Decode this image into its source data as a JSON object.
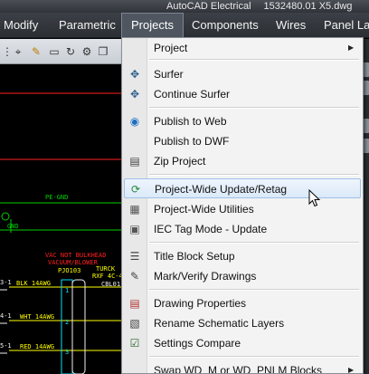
{
  "window": {
    "app_title": "AutoCAD Electrical",
    "document": "1532480.01 X5.dwg"
  },
  "menubar": {
    "items": [
      "Modify",
      "Parametric",
      "Projects",
      "Components",
      "Wires",
      "Panel Lay"
    ],
    "active": "Projects"
  },
  "drawing": {
    "labels": {
      "pe_gnd_top": "PE-GND",
      "gnd": "GND",
      "vac_note_1": "VAC NOT BULKHEAD",
      "vac_note_2": "VACUUM/BLOWER",
      "pjo103": "PJO103",
      "turck": "TURCK",
      "rxf": "RXF 4C-4C-",
      "blk": "BLK_14AWG",
      "wht": "WHT_14AWG",
      "red": "RED_14AWG",
      "cbl": "CBL01",
      "num_1": "1",
      "num_2": "2",
      "num_3": "3",
      "row_a": "3-1",
      "row_b": "4-1",
      "row_c": "5-1"
    },
    "colors": {
      "green": "#00d000",
      "yellow": "#ffff00",
      "red": "#ff2020",
      "cyan": "#00e0ff",
      "white": "#f0f0f0"
    }
  },
  "dropdown": {
    "items": [
      {
        "label": "Project",
        "icon": "none",
        "submenu": true
      },
      {
        "label": "Surfer",
        "icon": "surfer-icon"
      },
      {
        "label": "Continue Surfer",
        "icon": "continue-surfer-icon"
      },
      {
        "label": "Publish to Web",
        "icon": "publish-web-icon"
      },
      {
        "label": "Publish to DWF",
        "icon": "none"
      },
      {
        "label": "Zip Project",
        "icon": "zip-icon"
      },
      {
        "label": "Project-Wide Update/Retag",
        "icon": "update-retag-icon",
        "highlighted": true
      },
      {
        "label": "Project-Wide Utilities",
        "icon": "utilities-icon"
      },
      {
        "label": "IEC Tag Mode - Update",
        "icon": "iec-tag-icon"
      },
      {
        "label": "Title Block Setup",
        "icon": "title-block-icon"
      },
      {
        "label": "Mark/Verify Drawings",
        "icon": "mark-verify-icon"
      },
      {
        "label": "Drawing Properties",
        "icon": "drawing-properties-icon"
      },
      {
        "label": "Rename Schematic Layers",
        "icon": "rename-layers-icon"
      },
      {
        "label": "Settings Compare",
        "icon": "settings-compare-icon"
      },
      {
        "label": "Swap WD_M or WD_PNLM Blocks",
        "icon": "none",
        "submenu": true
      }
    ]
  }
}
